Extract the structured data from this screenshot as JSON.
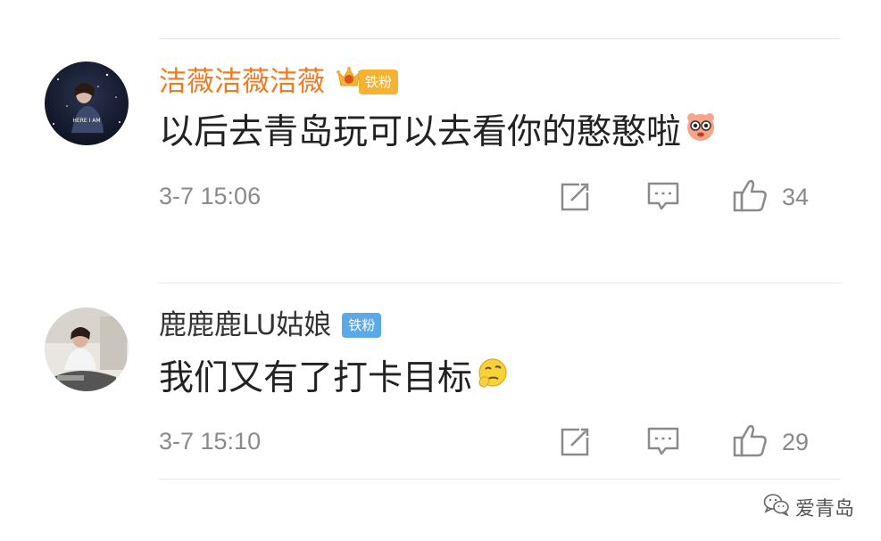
{
  "comments": [
    {
      "username": "洁薇洁薇洁薇",
      "badge": "铁粉",
      "text": "以后去青岛玩可以去看你的憨憨啦",
      "emoji_icon": "drooling-face-emoji",
      "avatar_caption": "HERE I AM",
      "time": "3-7 15:06",
      "likes": "34"
    },
    {
      "username": "鹿鹿鹿LU姑娘",
      "badge": "铁粉",
      "text": "我们又有了打卡目标",
      "emoji_icon": "thinking-face-emoji",
      "time": "3-7 15:10",
      "likes": "29"
    }
  ],
  "watermark": {
    "icon": "wechat-icon",
    "text": "爱青岛"
  },
  "colors": {
    "vip_name": "#f07a22",
    "normal_name": "#333333",
    "badge_gold": "#f6b333",
    "badge_blue": "#5aa9e8",
    "meta_gray": "#8a8a8a"
  }
}
